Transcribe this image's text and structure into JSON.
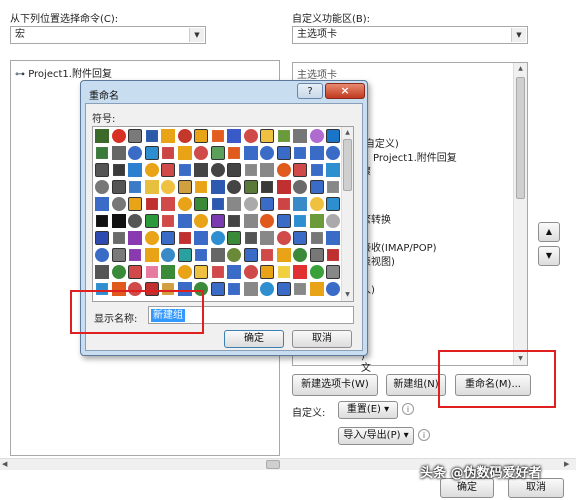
{
  "left_panel": {
    "commands_label": "从下列位置选择命令(C):",
    "commands_value": "宏",
    "tree_item": "Project1.附件回复"
  },
  "right_panel": {
    "customize_label": "自定义功能区(B):",
    "customize_value": "主选项卡",
    "tree_header": "主选项卡",
    "partial_rows": [
      "(自定义)",
      "Project1.附件回复",
      "骤",
      "繁转换",
      "接收(IMAP/POP)",
      "表视图)",
      "人)",
      ")",
      ")",
      ")",
      ")",
      ")",
      "文"
    ],
    "new_tab_button": "新建选项卡(W)",
    "new_group_button": "新建组(N)",
    "rename_button": "重命名(M)...",
    "customize_label2": "自定义:",
    "reset_button": "重置(E) ▾",
    "import_export_button": "导入/导出(P) ▾",
    "move_up": "▲",
    "move_down": "▼"
  },
  "dialog": {
    "title": "重命名",
    "help": "?",
    "close": "×",
    "symbol_label": "符号:",
    "display_name_label": "显示名称:",
    "display_name_value": "新建组",
    "ok_button": "确定",
    "cancel_button": "取消",
    "symbol_colors": [
      "#3b6b2a",
      "#d93025",
      "#7a7a7a",
      "#2b5aa8",
      "#e8a317",
      "#c4372b",
      "#e8a317",
      "#e35d1e",
      "#3a5bc7",
      "#d04a4a",
      "#f0c040",
      "#6a9a3a",
      "#777",
      "#b06bd0",
      "#1a75c8",
      "#3a7a3a",
      "#666",
      "#3a6bc7",
      "#2d8fd0",
      "#c44",
      "#e8a317",
      "#d04a4a",
      "#5aa05a",
      "#e05a1e",
      "#3a6bc7",
      "#3a6bc7",
      "#3a6bc7",
      "#3a6bc7",
      "#3a6bc7",
      "#3a6bc7",
      "#555",
      "#3a3a3a",
      "#2d7fd0",
      "#e8a317",
      "#d04a4a",
      "#3a6bc7",
      "#444",
      "#444",
      "#444",
      "#888",
      "#888",
      "#e05a1e",
      "#d04a4a",
      "#3a6bc7",
      "#2d8fd0",
      "#777",
      "#555",
      "#3a7ac7",
      "#e8c040",
      "#f0c040",
      "#d0a040",
      "#e8a317",
      "#2d5ab0",
      "#444",
      "#5a7a3a",
      "#3a3a3a",
      "#c03030",
      "#6a6a6a",
      "#3a6bc7",
      "#888",
      "#3a6bc7",
      "#777",
      "#e8a317",
      "#c03030",
      "#d04a4a",
      "#e8a317",
      "#3a8a3a",
      "#2d5ab0",
      "#888",
      "#aaa",
      "#3a6bc7",
      "#c44",
      "#3a8ac7",
      "#f0c040",
      "#2d8fd0",
      "#111",
      "#111",
      "#555",
      "#2a9a3a",
      "#d04a4a",
      "#3a6bc7",
      "#e8a317",
      "#7a3ab0",
      "#444",
      "#888",
      "#e05a1e",
      "#3a6bc7",
      "#2d8fd0",
      "#6a9a3a",
      "#aaa",
      "#2d4ab0",
      "#6a6a6a",
      "#8a3ab0",
      "#e8a317",
      "#3a6bc7",
      "#c03030",
      "#3a6bc7",
      "#2d8fd0",
      "#3a8a3a",
      "#555",
      "#888",
      "#d04a4a",
      "#3a6bc7",
      "#777",
      "#3a6bc7",
      "#3a6bc7",
      "#7a7a7a",
      "#8a3ab0",
      "#e8a317",
      "#3a8ac7",
      "#2aa0a0",
      "#3a6bc7",
      "#666",
      "#6a8a3a",
      "#3a6bc7",
      "#d04a4a",
      "#e8a317",
      "#3a8a3a",
      "#777",
      "#c03030",
      "#555",
      "#3a8a3a",
      "#d04a4a",
      "#e87aa0",
      "#3a8a3a",
      "#e8a317",
      "#f0c040",
      "#d04a4a",
      "#3a6bc7",
      "#d04a4a",
      "#e8a317",
      "#f0d040",
      "#e03030",
      "#3aa03a",
      "#888",
      "#2d8fd0",
      "#e05a1e",
      "#d04a4a",
      "#c03030",
      "#d0a040",
      "#3a6bc7",
      "#3a8a3a",
      "#3a6bc7",
      "#3a6bc7",
      "#888",
      "#2d8fd0",
      "#3a6bc7",
      "#888",
      "#e8a317",
      "#3a6bc7"
    ]
  },
  "bottom": {
    "ok": "确定",
    "cancel": "取消",
    "watermark": "头条 @伪数码爱好者"
  },
  "colors": {
    "highlight_border": "#e02020",
    "dialog_bg": "#c9ddf0",
    "selection": "#3399ff"
  }
}
